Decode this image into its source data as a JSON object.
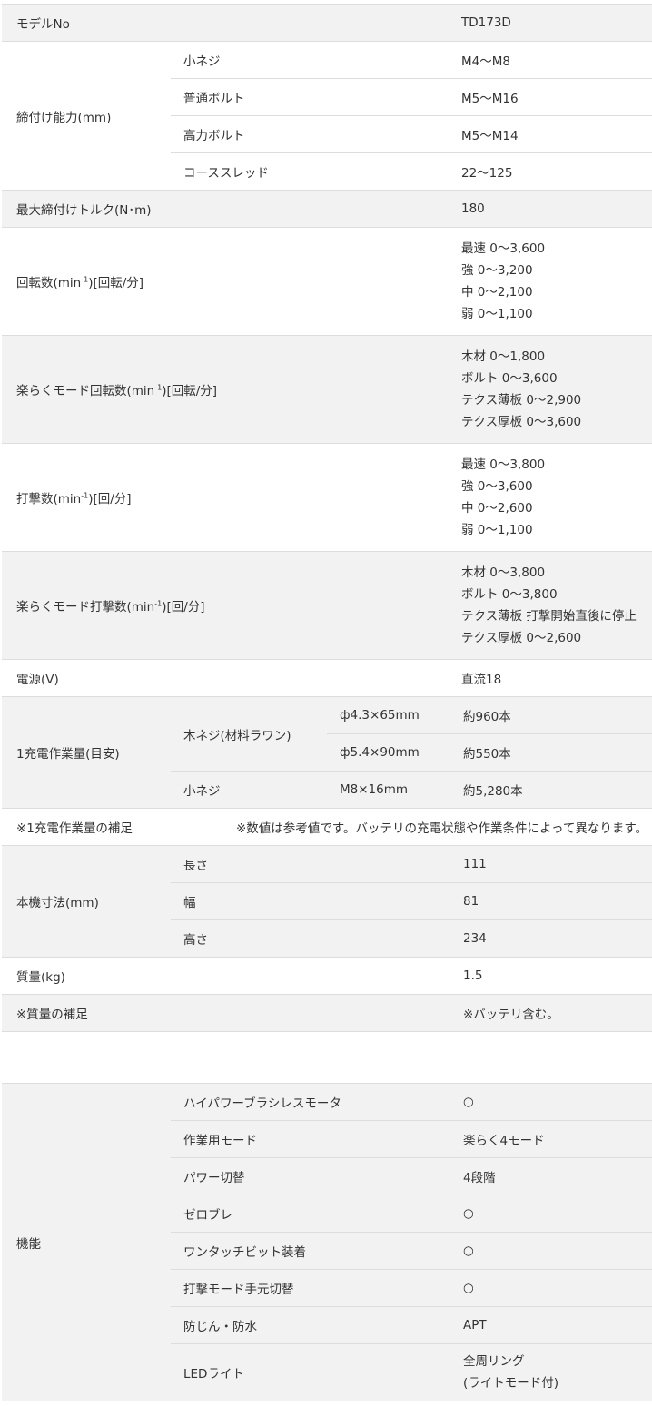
{
  "spec": {
    "model_label": "モデルNo",
    "model_value": "TD173D",
    "fastening_label": "締付け能力(mm)",
    "fastening": [
      {
        "name": "小ネジ",
        "value": "M4～M8"
      },
      {
        "name": "普通ボルト",
        "value": "M5～M16"
      },
      {
        "name": "高力ボルト",
        "value": "M5～M14"
      },
      {
        "name": "コーススレッド",
        "value": "22～125"
      }
    ],
    "max_torque_label": "最大締付けトルク(N･m)",
    "max_torque_value": "180",
    "rpm_label_pre": "回転数(min",
    "rpm_label_sup": "-1",
    "rpm_label_post": ")[回転/分]",
    "rpm_values": [
      "最速 0～3,600",
      "強 0～3,200",
      "中 0～2,100",
      "弱 0～1,100"
    ],
    "easy_rpm_label_pre": "楽らくモード回転数(min",
    "easy_rpm_label_sup": "-1",
    "easy_rpm_label_post": ")[回転/分]",
    "easy_rpm_values": [
      "木材 0～1,800",
      "ボルト 0～3,600",
      "テクス薄板 0～2,900",
      "テクス厚板 0～3,600"
    ],
    "ipm_label_pre": "打撃数(min",
    "ipm_label_sup": "-1",
    "ipm_label_post": ")[回/分]",
    "ipm_values": [
      "最速 0～3,800",
      "強 0～3,600",
      "中 0～2,600",
      "弱 0～1,100"
    ],
    "easy_ipm_label_pre": "楽らくモード打撃数(min",
    "easy_ipm_label_sup": "-1",
    "easy_ipm_label_post": ")[回/分]",
    "easy_ipm_values": [
      "木材 0～3,800",
      "ボルト 0～3,800",
      "テクス薄板 打撃開始直後に停止",
      "テクス厚板 0～2,600"
    ],
    "power_label": "電源(V)",
    "power_value": "直流18",
    "work_label": "1充電作業量(目安)",
    "work_wood_label": "木ネジ(材料ラワン)",
    "work_rows": [
      {
        "size": "ф4.3×65mm",
        "value": "約960本"
      },
      {
        "size": "ф5.4×90mm",
        "value": "約550本"
      }
    ],
    "work_machine_label": "小ネジ",
    "work_machine_size": "M8×16mm",
    "work_machine_value": "約5,280本",
    "work_note_label": "※1充電作業量の補足",
    "work_note_text": "※数値は参考値です。バッテリの充電状態や作業条件によって異なります。",
    "dims_label": "本機寸法(mm)",
    "dims": [
      {
        "name": "長さ",
        "value": "111"
      },
      {
        "name": "幅",
        "value": "81"
      },
      {
        "name": "高さ",
        "value": "234"
      }
    ],
    "mass_label": "質量(kg)",
    "mass_value": "1.5",
    "mass_note_label": "※質量の補足",
    "mass_note_text": "※バッテリ含む。"
  },
  "features": {
    "label": "機能",
    "items": [
      {
        "name": "ハイパワーブラシレスモータ",
        "value": "○"
      },
      {
        "name": "作業用モード",
        "value": "楽らく4モード"
      },
      {
        "name": "パワー切替",
        "value": "4段階"
      },
      {
        "name": "ゼロブレ",
        "value": "○"
      },
      {
        "name": "ワンタッチビット装着",
        "value": "○"
      },
      {
        "name": "打撃モード手元切替",
        "value": "○"
      },
      {
        "name": "防じん・防水",
        "value": "APT"
      }
    ],
    "led_name": "LEDライト",
    "led_values": [
      "全周リング",
      "(ライトモード付)"
    ]
  }
}
